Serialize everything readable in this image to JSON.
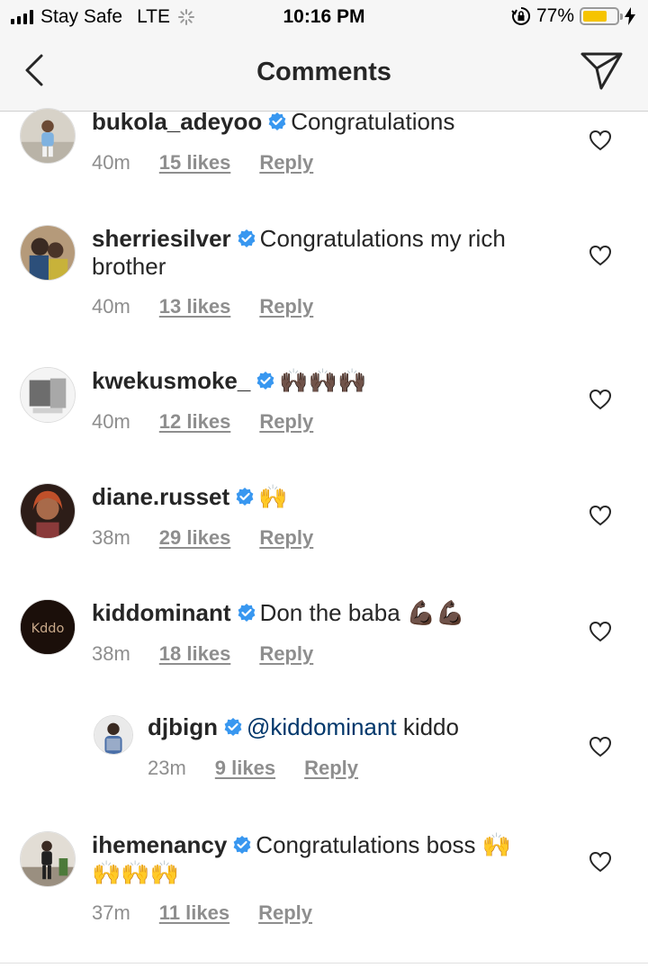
{
  "status_bar": {
    "carrier": "Stay Safe",
    "network": "LTE",
    "time": "10:16 PM",
    "battery": "77%",
    "battery_level": 0.77
  },
  "nav": {
    "title": "Comments",
    "back_icon": "chevron-left-icon",
    "send_icon": "paper-plane-icon"
  },
  "comments": [
    {
      "username": "bukola_adeyoo",
      "verified": true,
      "text": "Congratulations",
      "time": "40m",
      "likes": "15 likes",
      "reply": "Reply"
    },
    {
      "username": "sherriesilver",
      "verified": true,
      "text": "Congratulations my rich brother",
      "time": "40m",
      "likes": "13 likes",
      "reply": "Reply"
    },
    {
      "username": "kwekusmoke_",
      "verified": true,
      "text": "🙌🏿🙌🏿🙌🏿",
      "time": "40m",
      "likes": "12 likes",
      "reply": "Reply"
    },
    {
      "username": "diane.russet",
      "verified": true,
      "text": "🙌",
      "time": "38m",
      "likes": "29 likes",
      "reply": "Reply"
    },
    {
      "username": "kiddominant",
      "verified": true,
      "text": "Don the baba 💪🏿💪🏿",
      "time": "38m",
      "likes": "18 likes",
      "reply": "Reply",
      "avatar_text": "Kddo"
    },
    {
      "username": "djbign",
      "verified": true,
      "mention": "@kiddominant",
      "text": "kiddo",
      "time": "23m",
      "likes": "9 likes",
      "reply": "Reply",
      "is_reply": true
    },
    {
      "username": "ihemenancy",
      "verified": true,
      "text": "Congratulations boss 🙌",
      "text_line2": "🙌🙌🙌",
      "time": "37m",
      "likes": "11 likes",
      "reply": "Reply"
    }
  ],
  "colors": {
    "verified_blue": "#3897f0",
    "meta_gray": "#8e8e8e",
    "mention_blue": "#00376b",
    "battery_yellow": "#f6c400"
  }
}
